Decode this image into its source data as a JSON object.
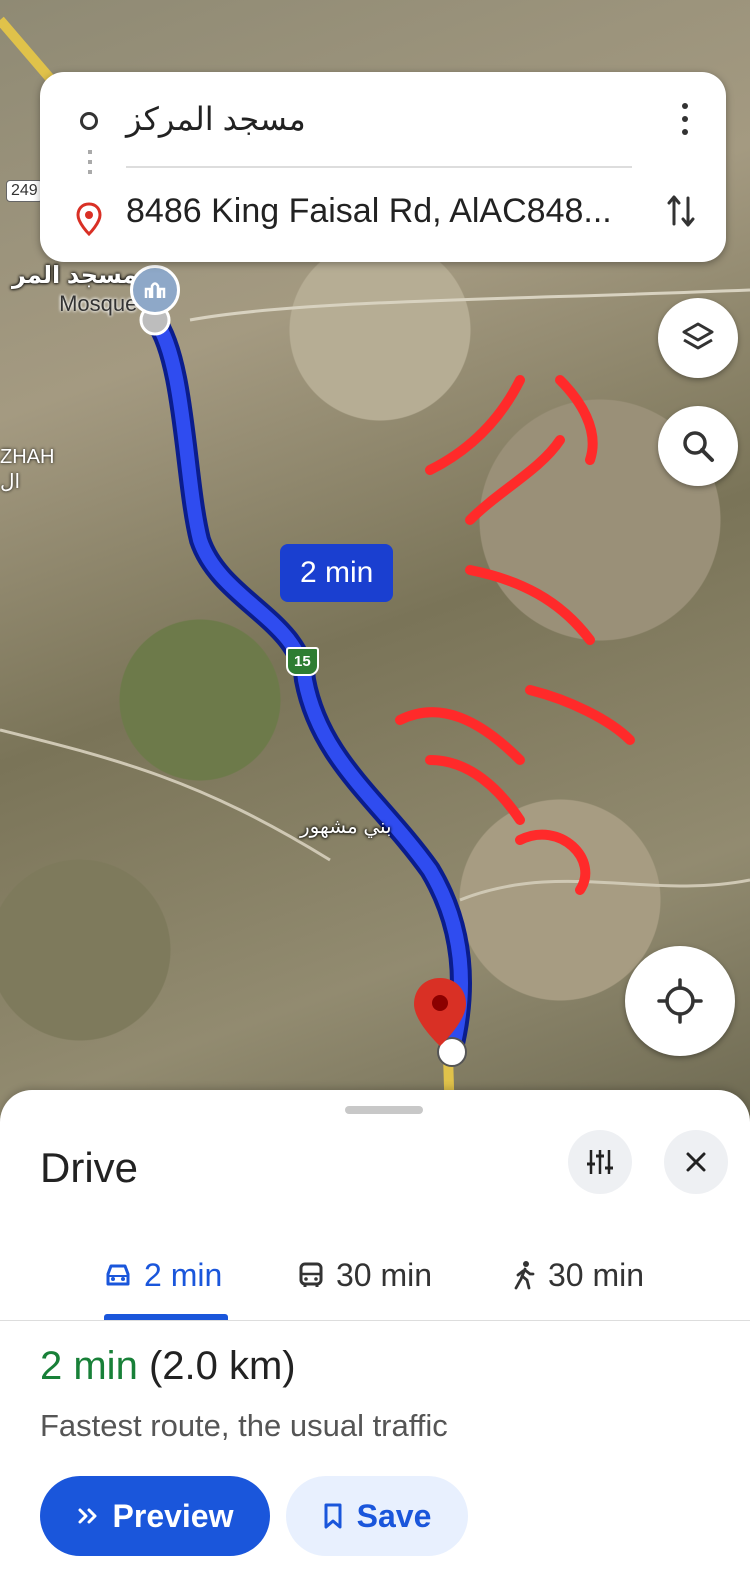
{
  "search": {
    "origin": "مسجد المركز",
    "destination": "8486 King Faisal Rd, AlAC848..."
  },
  "map": {
    "poi_name_ar": "مسجد المر",
    "poi_name_en": "Mosque",
    "area_label": "ZHAH",
    "area_label_ar": "ال",
    "town_label": "بني مشهور",
    "road_249": "249",
    "road_15": "15",
    "route_time": "2 min",
    "handwritten_note": "مسطح العماص ٢ كلم"
  },
  "sheet": {
    "title": "Drive",
    "tabs": [
      {
        "mode": "drive",
        "icon": "car-icon",
        "label": "2 min"
      },
      {
        "mode": "transit",
        "icon": "bus-icon",
        "label": "30 min"
      },
      {
        "mode": "walk",
        "icon": "walk-icon",
        "label": "30 min"
      }
    ],
    "duration": "2 min",
    "distance": "(2.0 km)",
    "description": "Fastest route, the usual traffic",
    "preview_label": "Preview",
    "save_label": "Save"
  },
  "colors": {
    "accent": "#1a56db",
    "route": "#1a3fd0",
    "duration_green": "#188038",
    "pin_red": "#d93025"
  }
}
